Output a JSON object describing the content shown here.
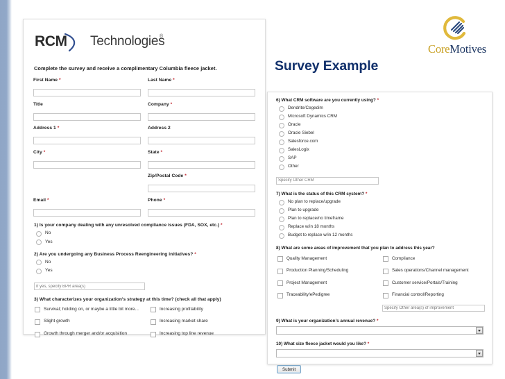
{
  "slide": {
    "title": "Survey Example"
  },
  "brand": {
    "rcm": {
      "mark": "RCM",
      "word": "Technologies",
      "tm": "®"
    },
    "coremotives": {
      "part1": "Core",
      "part2": "Motives"
    }
  },
  "form": {
    "intro": "Complete the survey and receive a complimentary Columbia fleece jacket.",
    "required_marker": "*",
    "fields": [
      [
        {
          "label": "First Name",
          "required": true,
          "value": "",
          "placeholder": ""
        },
        {
          "label": "Last Name",
          "required": true,
          "value": "",
          "placeholder": ""
        }
      ],
      [
        {
          "label": "Title",
          "required": false,
          "value": "",
          "placeholder": ""
        },
        {
          "label": "Company",
          "required": true,
          "value": "",
          "placeholder": ""
        }
      ],
      [
        {
          "label": "Address 1",
          "required": true,
          "value": "",
          "placeholder": ""
        },
        {
          "label": "Address 2",
          "required": false,
          "value": "",
          "placeholder": ""
        }
      ],
      [
        {
          "label": "City",
          "required": true,
          "value": "",
          "placeholder": ""
        },
        {
          "label": "State",
          "required": true,
          "value": "",
          "placeholder": ""
        }
      ],
      [
        {
          "label": "",
          "required": false,
          "value": "",
          "placeholder": "",
          "hidden": true
        },
        {
          "label": "Zip/Postal Code",
          "required": true,
          "value": "",
          "placeholder": ""
        }
      ],
      [
        {
          "label": "Email",
          "required": true,
          "value": "",
          "placeholder": ""
        },
        {
          "label": "Phone",
          "required": true,
          "value": "",
          "placeholder": ""
        }
      ]
    ],
    "q1": {
      "title": "1) Is your company dealing with any unresolved compliance issues (FDA, SOX, etc.)",
      "required": true,
      "options": [
        "No",
        "Yes"
      ]
    },
    "q2": {
      "title": "2) Are you undergoing any Business Process Reengineering initiatives?",
      "required": true,
      "options": [
        "No",
        "Yes"
      ],
      "other_placeholder": "If yes, specify BPR area(s)"
    },
    "q3": {
      "title": "3) What characterizes your organization's strategy at this time? (check all that apply)",
      "required": false,
      "options": [
        "Survival; holding on, or maybe a little bit more...",
        "Increasing profitability",
        "Slight growth",
        "Increasing market share",
        "Growth through merger and/or acquisition",
        "Increasing top line revenue"
      ]
    },
    "q6": {
      "title": "6) What CRM software are you currently using?",
      "required": true,
      "options": [
        "Dendrite/Cegedim",
        "Microsoft Dynamics CRM",
        "Oracle",
        "Oracle Siebel",
        "Salesforce.com",
        "SalesLogix",
        "SAP",
        "Other"
      ],
      "other_placeholder": "Specify Other CRM"
    },
    "q7": {
      "title": "7) What is the status of this CRM system?",
      "required": true,
      "options": [
        "No plan to replace/upgrade",
        "Plan to upgrade",
        "Plan to replace/no timeframe",
        "Replace w/in 18 months",
        "Budget to replace w/in 12 months"
      ]
    },
    "q8": {
      "title": "8) What are some areas of improvement that you plan to address this year?",
      "required": false,
      "options": [
        "Quality Management",
        "Compliance",
        "Production Planning/Scheduling",
        "Sales operations/Channel management",
        "Project Management",
        "Customer service/Portals/Training",
        "Traceability/ePedigree",
        "Financial control/Reporting"
      ],
      "other_placeholder": "Specify Other area(s) of improvement"
    },
    "q9": {
      "title": "9) What is your organization's annual revenue?",
      "required": true,
      "selected": ""
    },
    "q10": {
      "title": "10) What size fleece jacket would you like?",
      "required": true,
      "selected": ""
    },
    "submit_label": "Submit"
  }
}
